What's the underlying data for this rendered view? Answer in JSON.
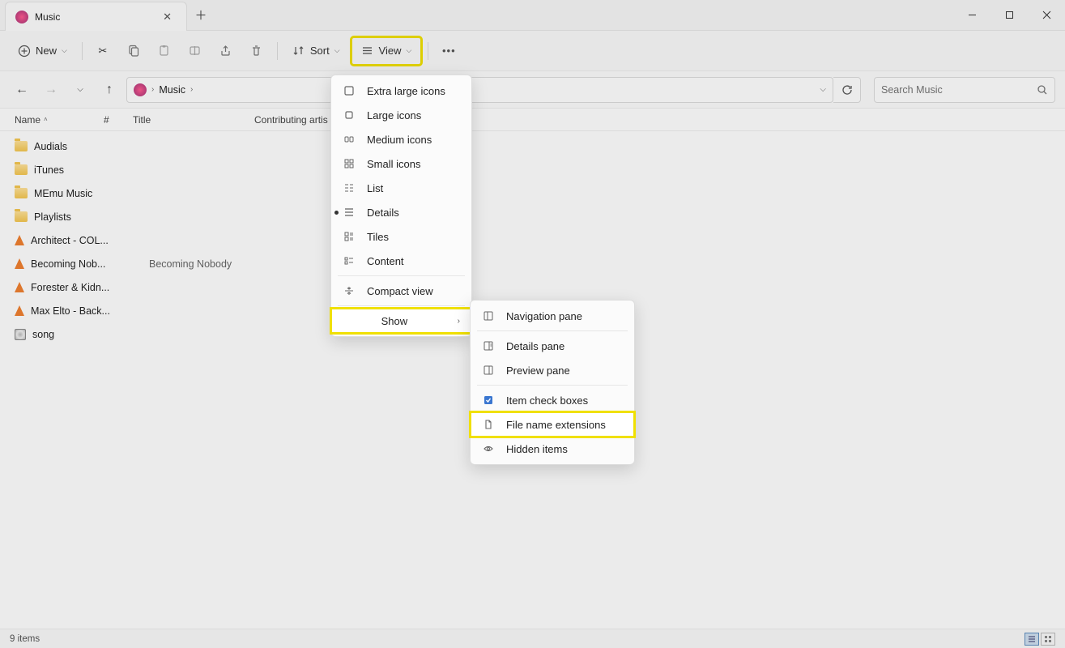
{
  "tab": {
    "title": "Music"
  },
  "toolbar": {
    "new": "New",
    "sort": "Sort",
    "view": "View"
  },
  "breadcrumb": {
    "item": "Music"
  },
  "search": {
    "placeholder": "Search Music"
  },
  "columns": {
    "name": "Name",
    "num": "#",
    "title": "Title",
    "artist": "Contributing artis"
  },
  "rows": [
    {
      "name": "Audials",
      "type": "folder"
    },
    {
      "name": "iTunes",
      "type": "folder"
    },
    {
      "name": "MEmu Music",
      "type": "folder"
    },
    {
      "name": "Playlists",
      "type": "folder"
    },
    {
      "name": "Architect - COL...",
      "type": "vlc"
    },
    {
      "name": "Becoming Nob...",
      "type": "vlc",
      "title": "Becoming Nobody"
    },
    {
      "name": "Forester & Kidn...",
      "type": "vlc"
    },
    {
      "name": "Max Elto - Back...",
      "type": "vlc"
    },
    {
      "name": "song",
      "type": "disc"
    }
  ],
  "view_menu": {
    "xl": "Extra large icons",
    "large": "Large icons",
    "medium": "Medium icons",
    "small": "Small icons",
    "list": "List",
    "details": "Details",
    "tiles": "Tiles",
    "content": "Content",
    "compact": "Compact view",
    "show": "Show"
  },
  "show_menu": {
    "nav": "Navigation pane",
    "details": "Details pane",
    "preview": "Preview pane",
    "checks": "Item check boxes",
    "ext": "File name extensions",
    "hidden": "Hidden items"
  },
  "status": {
    "count": "9 items"
  }
}
